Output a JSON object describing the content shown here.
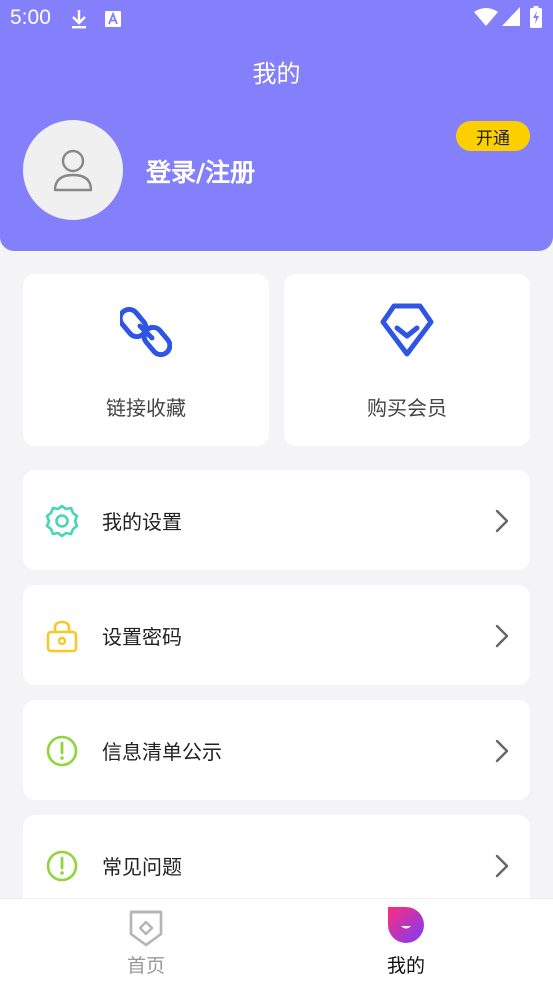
{
  "status_bar": {
    "time": "5:00"
  },
  "header": {
    "title": "我的",
    "login_label": "登录/注册",
    "vip_badge": "开通"
  },
  "cards": [
    {
      "label": "链接收藏",
      "icon": "link-icon"
    },
    {
      "label": "购买会员",
      "icon": "vip-shield-icon"
    }
  ],
  "menu": [
    {
      "label": "我的设置",
      "icon": "gear-icon"
    },
    {
      "label": "设置密码",
      "icon": "lock-icon"
    },
    {
      "label": "信息清单公示",
      "icon": "alert-circle-icon"
    },
    {
      "label": "常见问题",
      "icon": "alert-circle-icon"
    }
  ],
  "bottom_nav": [
    {
      "label": "首页",
      "active": false
    },
    {
      "label": "我的",
      "active": true
    }
  ],
  "colors": {
    "header_bg": "#8480fb",
    "badge": "#fcd000",
    "link_blue": "#2f55e4",
    "gear_teal": "#43d7b4",
    "lock_yellow": "#f5c926",
    "alert_green": "#8fd63a",
    "page_bg": "#f4f4f6"
  }
}
